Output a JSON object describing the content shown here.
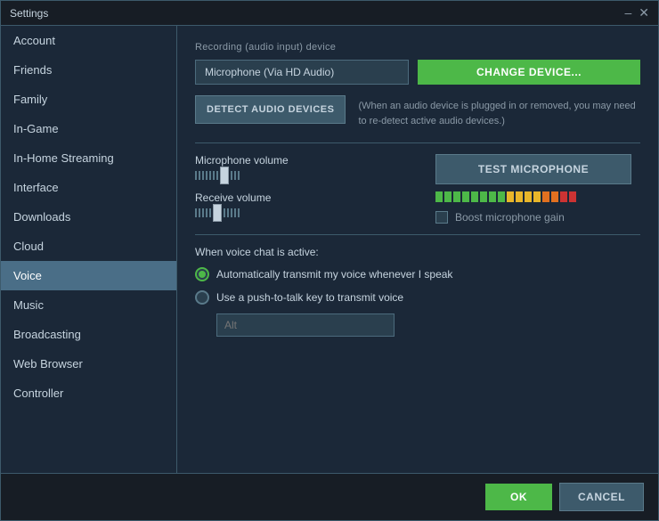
{
  "window": {
    "title": "Settings",
    "close_symbol": "✕",
    "minimize_symbol": "–"
  },
  "sidebar": {
    "items": [
      {
        "id": "account",
        "label": "Account",
        "active": false
      },
      {
        "id": "friends",
        "label": "Friends",
        "active": false
      },
      {
        "id": "family",
        "label": "Family",
        "active": false
      },
      {
        "id": "in-game",
        "label": "In-Game",
        "active": false
      },
      {
        "id": "in-home-streaming",
        "label": "In-Home Streaming",
        "active": false
      },
      {
        "id": "interface",
        "label": "Interface",
        "active": false
      },
      {
        "id": "downloads",
        "label": "Downloads",
        "active": false
      },
      {
        "id": "cloud",
        "label": "Cloud",
        "active": false
      },
      {
        "id": "voice",
        "label": "Voice",
        "active": true
      },
      {
        "id": "music",
        "label": "Music",
        "active": false
      },
      {
        "id": "broadcasting",
        "label": "Broadcasting",
        "active": false
      },
      {
        "id": "web-browser",
        "label": "Web Browser",
        "active": false
      },
      {
        "id": "controller",
        "label": "Controller",
        "active": false
      }
    ]
  },
  "content": {
    "recording_label": "Recording (audio input) device",
    "device_value": "Microphone (Via HD Audio)",
    "change_device_label": "CHANGE DEVICE...",
    "detect_audio_label": "DETECT AUDIO DEVICES",
    "detect_note": "(When an audio device is plugged in or removed, you may\nneed to re-detect active audio devices.)",
    "microphone_volume_label": "Microphone volume",
    "test_microphone_label": "TEST MICROPHONE",
    "receive_volume_label": "Receive volume",
    "boost_microphone_label": "Boost microphone gain",
    "voice_active_label": "When voice chat is active:",
    "auto_transmit_label": "Automatically transmit my voice whenever I speak",
    "push_to_talk_label": "Use a push-to-talk key to transmit voice",
    "push_to_talk_placeholder": "Alt"
  },
  "footer": {
    "ok_label": "OK",
    "cancel_label": "CANCEL"
  }
}
